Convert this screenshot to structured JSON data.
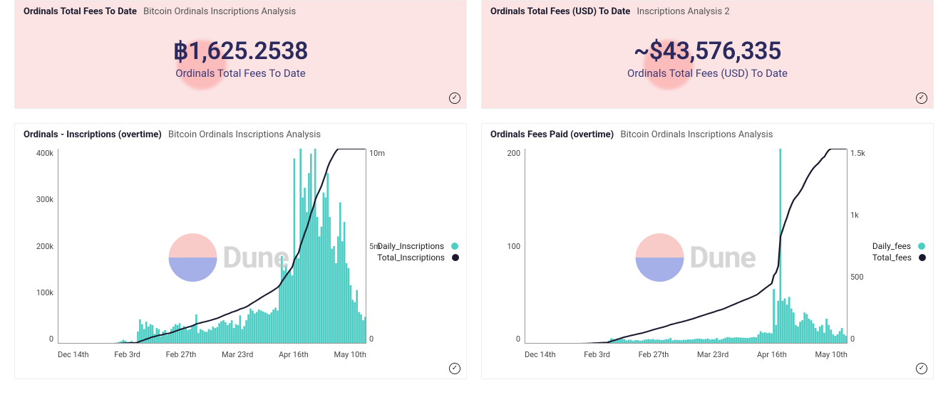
{
  "panels": {
    "fees_btc": {
      "title": "Ordinals Total Fees To Date",
      "subtitle": "Bitcoin Ordinals Inscriptions Analysis",
      "value": "฿1,625.2538",
      "label": "Ordinals Total Fees To Date"
    },
    "fees_usd": {
      "title": "Ordinals Total Fees (USD) To Date",
      "subtitle": "Inscriptions Analysis 2",
      "value": "~$43,576,335",
      "label": "Ordinals Total Fees (USD) To Date"
    },
    "inscriptions": {
      "title": "Ordinals - Inscriptions (overtime)",
      "subtitle": "Bitcoin Ordinals Inscriptions Analysis",
      "legend": {
        "bars": "Daily_Inscriptions",
        "line": "Total_Inscriptions"
      }
    },
    "fees_chart": {
      "title": "Ordinals Fees Paid (overtime)",
      "subtitle": "Bitcoin Ordinals Inscriptions Analysis",
      "legend": {
        "bars": "Daily_fees",
        "line": "Total_fees"
      }
    }
  },
  "watermark": "Dune",
  "chart_data": [
    {
      "id": "inscriptions",
      "type": "bar+line",
      "x_ticks": [
        "Dec 14th",
        "Feb 3rd",
        "Feb 27th",
        "Mar 23rd",
        "Apr 16th",
        "May 10th"
      ],
      "y_left_ticks": [
        "400k",
        "300k",
        "200k",
        "100k",
        "0"
      ],
      "y_right_ticks": [
        "10m",
        "5m",
        "0"
      ],
      "y_left_label": "",
      "y_right_label": "",
      "y_left_range": [
        0,
        400000
      ],
      "y_right_range": [
        0,
        10000000
      ],
      "bars_series_name": "Daily_Inscriptions",
      "line_series_name": "Total_Inscriptions",
      "bars": [
        0,
        0,
        0,
        0,
        0,
        0,
        0,
        0,
        0,
        0,
        0,
        0,
        0,
        0,
        0,
        0,
        0,
        0,
        0,
        0,
        0,
        0,
        0,
        0,
        0,
        300,
        500,
        1000,
        2000,
        3500,
        5000,
        8000,
        6000,
        3000,
        4000,
        5500,
        2500,
        2000,
        25000,
        50000,
        40000,
        30000,
        45000,
        35000,
        40000,
        38000,
        20000,
        32000,
        30000,
        15000,
        25000,
        28000,
        18000,
        22000,
        30000,
        35000,
        40000,
        38000,
        42000,
        30000,
        36000,
        32000,
        28000,
        30000,
        38000,
        40000,
        60000,
        22000,
        30000,
        28000,
        25000,
        24000,
        30000,
        28000,
        35000,
        32000,
        34000,
        42000,
        46000,
        48000,
        44000,
        38000,
        42000,
        48000,
        32000,
        40000,
        38000,
        58000,
        30000,
        36000,
        48000,
        60000,
        72000,
        68000,
        62000,
        65000,
        70000,
        68000,
        66000,
        64000,
        62000,
        60000,
        64000,
        70000,
        74000,
        68000,
        120000,
        180000,
        150000,
        160000,
        145000,
        152000,
        140000,
        380000,
        180000,
        175000,
        400000,
        300000,
        320000,
        270000,
        350000,
        390000,
        280000,
        400000,
        260000,
        220000,
        240000,
        310000,
        300000,
        350000,
        260000,
        195000,
        200000,
        165000,
        220000,
        290000,
        210000,
        250000,
        165000,
        155000,
        120000,
        90000,
        85000,
        110000,
        65000,
        60000,
        48000,
        55000
      ],
      "line": [
        0,
        0,
        0,
        0,
        0,
        0,
        0,
        0,
        0,
        0,
        0,
        0,
        0,
        0,
        0,
        0,
        0,
        0,
        0,
        0,
        0,
        0,
        0,
        0,
        0,
        0.003,
        0.008,
        0.018,
        0.038,
        0.073,
        0.123,
        0.203,
        0.263,
        0.293,
        0.333,
        0.388,
        0.413,
        0.433,
        0.683,
        1.183,
        1.583,
        1.883,
        2.333,
        2.683,
        3.083,
        3.463,
        3.663,
        3.983,
        4.283,
        4.433,
        4.683,
        4.963,
        5.143,
        5.363,
        5.663,
        6.013,
        6.413,
        6.793,
        7.213,
        7.513,
        7.873,
        8.193,
        8.473,
        8.773,
        9.153,
        9.553,
        10.153,
        10.373,
        10.673,
        10.953,
        11.203,
        11.443,
        11.743,
        12.023,
        12.373,
        12.693,
        13.033,
        13.453,
        13.913,
        14.393,
        14.833,
        15.213,
        15.633,
        16.113,
        16.433,
        16.833,
        17.213,
        17.793,
        18.093,
        18.453,
        18.933,
        19.533,
        20.253,
        20.933,
        21.553,
        22.203,
        22.903,
        23.583,
        24.243,
        24.883,
        25.503,
        26.103,
        26.743,
        27.443,
        28.183,
        28.863,
        30.063,
        31.863,
        33.363,
        34.963,
        36.413,
        37.933,
        39.333,
        43.133,
        44.933,
        46.683,
        50.683,
        53.683,
        56.883,
        59.583,
        63.083,
        66.983,
        69.783,
        73.783,
        76.383,
        78.583,
        80.983,
        84.083,
        87.083,
        90.583,
        93.183,
        95.133,
        97.133,
        98.783,
        100.0,
        100.0,
        100.0,
        100.0,
        100.0,
        100.0,
        100.0,
        100.0,
        100.0,
        100.0,
        100.0,
        100.0,
        100.0,
        100.0
      ],
      "line_scale_note": "line[] values are percentages of y_right max (10m) for plotting; actual cumulative reaches ≈10,000,000"
    },
    {
      "id": "fees",
      "type": "bar+line",
      "x_ticks": [
        "Dec 14th",
        "Feb 3rd",
        "Feb 27th",
        "Mar 23rd",
        "Apr 16th",
        "May 10th"
      ],
      "y_left_ticks": [
        "200",
        "100",
        "0"
      ],
      "y_right_ticks": [
        "1.5k",
        "1k",
        "500",
        "0"
      ],
      "y_left_label": "",
      "y_right_label": "",
      "y_left_range": [
        0,
        250
      ],
      "y_right_range": [
        0,
        1650
      ],
      "bars_series_name": "Daily_fees",
      "line_series_name": "Total_fees",
      "bars": [
        0,
        0,
        0,
        0,
        0,
        0,
        0,
        0,
        0,
        0,
        0,
        0,
        0,
        0,
        0,
        0,
        0,
        0,
        0,
        0,
        0,
        0,
        0,
        0,
        0,
        0.1,
        0.2,
        0.3,
        0.5,
        0.8,
        1.0,
        1.4,
        1.2,
        0.8,
        1.0,
        1.1,
        0.7,
        0.6,
        4,
        7,
        6,
        5,
        6.5,
        5.5,
        6,
        5.8,
        4,
        5,
        4.8,
        3.5,
        4.4,
        4.6,
        3.8,
        4,
        5,
        5.4,
        5.8,
        5.5,
        6,
        5,
        5.3,
        5,
        4.5,
        5,
        5.6,
        6,
        7.5,
        4.2,
        5,
        4.8,
        4.5,
        4.4,
        5,
        4.8,
        5.5,
        5.2,
        5.4,
        6,
        6.3,
        6.5,
        6.2,
        5.6,
        6,
        6.5,
        5.2,
        5.8,
        5.6,
        7.4,
        5,
        5.3,
        6.4,
        7.5,
        8.4,
        8,
        7.6,
        7.8,
        8.2,
        8,
        7.8,
        7.6,
        7.4,
        7.2,
        7.6,
        8.2,
        8.5,
        8,
        12,
        16,
        14,
        14.5,
        13.5,
        14,
        13.2,
        70,
        24,
        55,
        250,
        55,
        58,
        50,
        60,
        45,
        40,
        24,
        22,
        28,
        30,
        40,
        38,
        32,
        30,
        26,
        20,
        16,
        22,
        24,
        14,
        32,
        24,
        18,
        12,
        10,
        12,
        16,
        20,
        12,
        10
      ],
      "line": [
        0,
        0,
        0,
        0,
        0,
        0,
        0,
        0,
        0,
        0,
        0,
        0,
        0,
        0,
        0,
        0,
        0,
        0,
        0,
        0,
        0,
        0,
        0,
        0,
        0,
        0.006,
        0.018,
        0.036,
        0.067,
        0.115,
        0.176,
        0.261,
        0.333,
        0.382,
        0.442,
        0.509,
        0.552,
        0.588,
        0.83,
        1.255,
        1.618,
        1.921,
        2.315,
        2.648,
        3.012,
        3.364,
        3.606,
        3.909,
        4.2,
        4.412,
        4.679,
        4.958,
        5.188,
        5.43,
        5.733,
        6.061,
        6.412,
        6.745,
        7.109,
        7.412,
        7.733,
        8.036,
        8.309,
        8.612,
        8.952,
        9.315,
        9.77,
        10.024,
        10.327,
        10.618,
        10.891,
        11.158,
        11.461,
        11.752,
        12.085,
        12.4,
        12.727,
        13.091,
        13.473,
        13.867,
        14.242,
        14.582,
        14.945,
        15.339,
        15.655,
        16.006,
        16.345,
        16.794,
        17.097,
        17.418,
        17.806,
        18.261,
        18.77,
        19.255,
        19.715,
        20.188,
        20.685,
        21.17,
        21.642,
        22.103,
        22.552,
        22.988,
        23.448,
        23.945,
        24.461,
        24.945,
        25.673,
        26.642,
        27.491,
        28.37,
        29.188,
        30.036,
        30.836,
        35.079,
        36.533,
        39.867,
        55.018,
        58.352,
        61.867,
        64.897,
        68.533,
        71.261,
        73.685,
        75.139,
        76.473,
        78.17,
        79.988,
        82.412,
        84.715,
        86.655,
        88.473,
        90.048,
        91.261,
        92.23,
        93.564,
        95.018,
        95.867,
        97.806,
        99.261,
        100.0,
        100.0,
        100.0,
        100.0,
        100.0,
        100.0,
        100.0,
        100.0
      ],
      "line_scale_note": "line[] values are percentages of y_right max (1650) for plotting; actual cumulative reaches ≈1,625 BTC"
    }
  ]
}
